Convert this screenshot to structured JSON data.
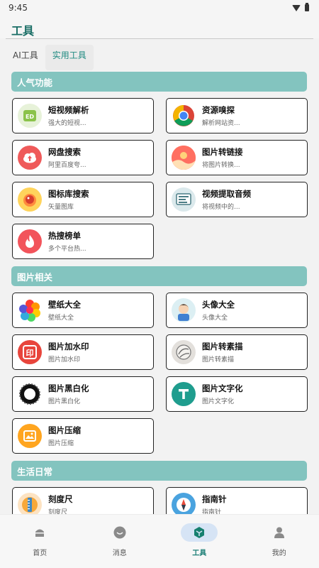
{
  "status": {
    "time": "9:45"
  },
  "header": {
    "title": "工具"
  },
  "tabs": [
    {
      "label": "AI工具",
      "active": false
    },
    {
      "label": "实用工具",
      "active": true
    }
  ],
  "sections": [
    {
      "title": "人气功能",
      "items": [
        {
          "title": "短视频解析",
          "subtitle": "强大的短视...",
          "icon": "video-parse-icon"
        },
        {
          "title": "资源嗅探",
          "subtitle": "解析网站资...",
          "icon": "chrome-icon"
        },
        {
          "title": "网盘搜索",
          "subtitle": "阿里百度夸...",
          "icon": "cloud-upload-icon"
        },
        {
          "title": "图片转链接",
          "subtitle": "将图片转换...",
          "icon": "landscape-icon"
        },
        {
          "title": "图标库搜索",
          "subtitle": "矢量图库",
          "icon": "icon-library-icon"
        },
        {
          "title": "视频提取音频",
          "subtitle": "将视频中的...",
          "icon": "audio-extract-icon"
        },
        {
          "title": "热搜榜单",
          "subtitle": "多个平台热...",
          "icon": "flame-icon"
        }
      ]
    },
    {
      "title": "图片相关",
      "items": [
        {
          "title": "壁纸大全",
          "subtitle": "壁纸大全",
          "icon": "flower-icon"
        },
        {
          "title": "头像大全",
          "subtitle": "头像大全",
          "icon": "avatar-icon"
        },
        {
          "title": "图片加水印",
          "subtitle": "图片加水印",
          "icon": "stamp-icon"
        },
        {
          "title": "图片转素描",
          "subtitle": "图片转素描",
          "icon": "sketch-icon"
        },
        {
          "title": "图片黑白化",
          "subtitle": "图片黑白化",
          "icon": "black-white-icon"
        },
        {
          "title": "图片文字化",
          "subtitle": "图片文字化",
          "icon": "text-icon"
        },
        {
          "title": "图片压缩",
          "subtitle": "图片压缩",
          "icon": "compress-icon"
        }
      ]
    },
    {
      "title": "生活日常",
      "items": [
        {
          "title": "刻度尺",
          "subtitle": "刻度尺",
          "icon": "ruler-icon"
        },
        {
          "title": "指南针",
          "subtitle": "指南针",
          "icon": "compass-icon"
        }
      ]
    }
  ],
  "bottom_nav": [
    {
      "label": "首页",
      "icon": "home-icon",
      "active": false
    },
    {
      "label": "消息",
      "icon": "message-icon",
      "active": false
    },
    {
      "label": "工具",
      "icon": "tools-icon",
      "active": true
    },
    {
      "label": "我的",
      "icon": "profile-icon",
      "active": false
    }
  ],
  "colors": {
    "accent": "#1f8a80",
    "section_header": "#83c4bf",
    "nav_active_bg": "#d6e4f5"
  }
}
